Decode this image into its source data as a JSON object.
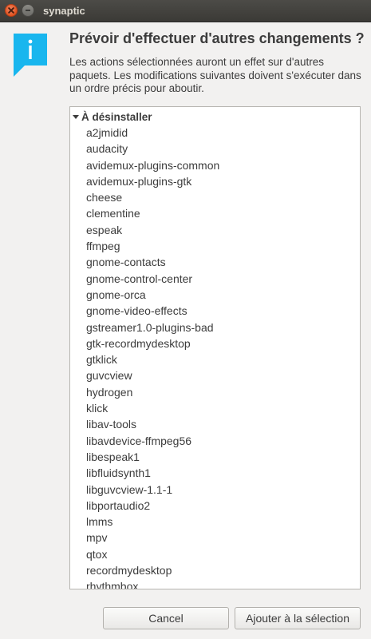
{
  "window": {
    "title": "synaptic"
  },
  "dialog": {
    "heading": "Prévoir d'effectuer d'autres changements ?",
    "description": "Les actions sélectionnées auront un effet sur d'autres paquets. Les modifications suivantes doivent s'exécuter dans un ordre précis pour aboutir.",
    "icon": "info-icon",
    "accent_color": "#19b6ee"
  },
  "changes": {
    "group_label": "À désinstaller",
    "expanded": true,
    "items": [
      "a2jmidid",
      "audacity",
      "avidemux-plugins-common",
      "avidemux-plugins-gtk",
      "cheese",
      "clementine",
      "espeak",
      "ffmpeg",
      "gnome-contacts",
      "gnome-control-center",
      "gnome-orca",
      "gnome-video-effects",
      "gstreamer1.0-plugins-bad",
      "gtk-recordmydesktop",
      "gtklick",
      "guvcview",
      "hydrogen",
      "klick",
      "libav-tools",
      "libavdevice-ffmpeg56",
      "libespeak1",
      "libfluidsynth1",
      "libguvcview-1.1-1",
      "libportaudio2",
      "lmms",
      "mpv",
      "qtox",
      "recordmydesktop",
      "rhythmbox"
    ]
  },
  "buttons": {
    "cancel": "Cancel",
    "add": "Ajouter à la sélection"
  }
}
